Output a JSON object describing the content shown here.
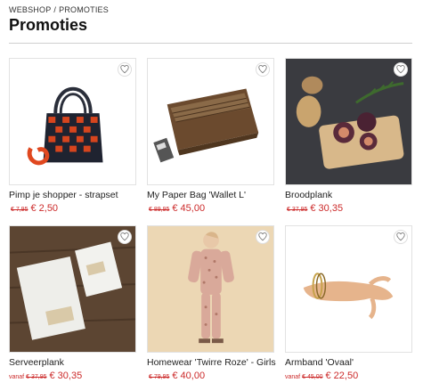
{
  "breadcrumb": {
    "home": "WEBSHOP",
    "separator": "/",
    "current": "PROMOTIES"
  },
  "page_title": "Promoties",
  "icons": {
    "favorite": "heart-icon"
  },
  "colors": {
    "sale": "#cc2a2a",
    "text": "#222222",
    "divider": "#cfcfcf"
  },
  "products": [
    {
      "name": "Pimp je shopper - strapset",
      "from": "",
      "old_price": "€ 7,95",
      "new_price": "€ 2,50"
    },
    {
      "name": "My Paper Bag 'Wallet L'",
      "from": "",
      "old_price": "€ 89,95",
      "new_price": "€ 45,00"
    },
    {
      "name": "Broodplank",
      "from": "",
      "old_price": "€ 37,95",
      "new_price": "€ 30,35"
    },
    {
      "name": "Serveerplank",
      "from": "vanaf",
      "old_price": "€ 37,95",
      "new_price": "€ 30,35"
    },
    {
      "name": "Homewear 'Twirre Roze' - Girls",
      "from": "",
      "old_price": "€ 79,95",
      "new_price": "€ 40,00"
    },
    {
      "name": "Armband 'Ovaal'",
      "from": "vanaf",
      "old_price": "€ 45,00",
      "new_price": "€ 22,50"
    }
  ]
}
